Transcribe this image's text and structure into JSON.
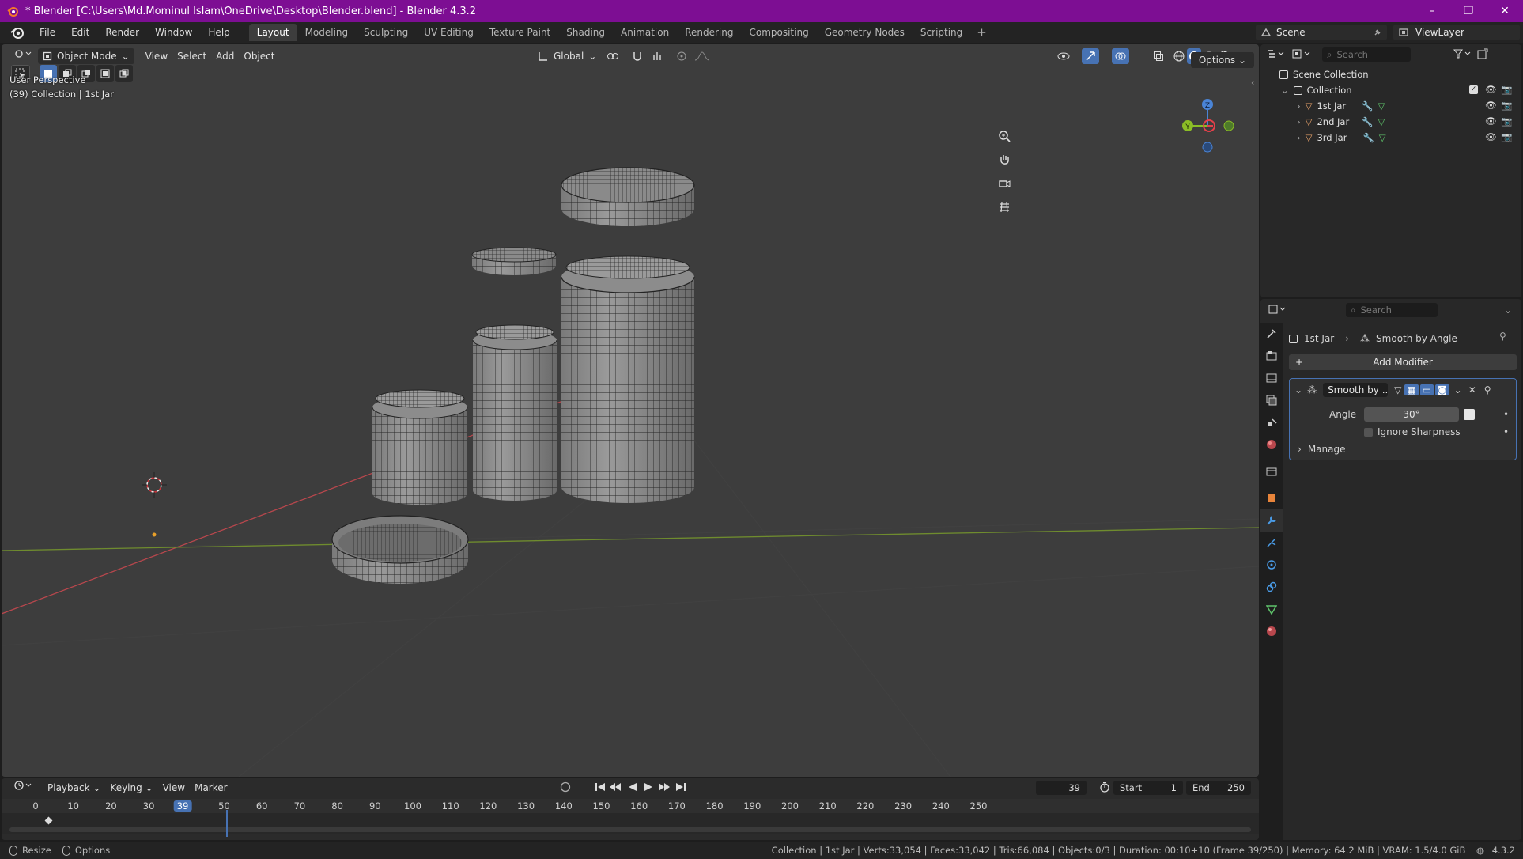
{
  "window": {
    "title": "* Blender [C:\\Users\\Md.Mominul Islam\\OneDrive\\Desktop\\Blender.blend] - Blender 4.3.2",
    "controls": [
      "–",
      "❐",
      "✕"
    ]
  },
  "menubar": {
    "items": [
      "File",
      "Edit",
      "Render",
      "Window",
      "Help"
    ],
    "workspaces": [
      "Layout",
      "Modeling",
      "Sculpting",
      "UV Editing",
      "Texture Paint",
      "Shading",
      "Animation",
      "Rendering",
      "Compositing",
      "Geometry Nodes",
      "Scripting"
    ],
    "active_workspace": "Layout",
    "add_tab": "+",
    "scene": "Scene",
    "view_layer": "ViewLayer"
  },
  "viewport": {
    "mode": "Object Mode",
    "menus": [
      "View",
      "Select",
      "Add",
      "Object"
    ],
    "transform_orientation": "Global",
    "options_label": "Options",
    "perspective": "User Perspective",
    "collection_info": "(39) Collection | 1st Jar",
    "gizmo_axes": [
      "Z",
      "Y",
      "X"
    ]
  },
  "timeline": {
    "menus": [
      "Playback",
      "Keying",
      "View",
      "Marker"
    ],
    "current_frame": "39",
    "start_label": "Start",
    "start_value": "1",
    "end_label": "End",
    "end_value": "250",
    "ruler": [
      "0",
      "10",
      "20",
      "30",
      "39",
      "50",
      "60",
      "70",
      "80",
      "90",
      "100",
      "110",
      "120",
      "130",
      "140",
      "150",
      "160",
      "170",
      "180",
      "190",
      "200",
      "210",
      "220",
      "230",
      "240",
      "250"
    ]
  },
  "statusbar": {
    "left": [
      "Resize",
      "Options"
    ],
    "right": "Collection | 1st Jar | Verts:33,054 | Faces:33,042 | Tris:66,084 | Objects:0/3 | Duration: 00:10+10 (Frame 39/250) | Memory: 64.2 MiB | VRAM: 1.5/4.0 GiB",
    "version": "4.3.2"
  },
  "outliner": {
    "search_placeholder": "Search",
    "scene_collection": "Scene Collection",
    "collection": "Collection",
    "objects": [
      "1st Jar",
      "2nd Jar",
      "3rd Jar"
    ]
  },
  "properties": {
    "search_placeholder": "Search",
    "breadcrumb_object": "1st Jar",
    "breadcrumb_modifier": "Smooth by Angle",
    "add_modifier": "Add Modifier",
    "modifier_name": "Smooth by ...",
    "angle_label": "Angle",
    "angle_value": "30°",
    "ignore_sharpness": "Ignore Sharpness",
    "manage": "Manage"
  },
  "colors": {
    "titlebar": "#7d0e93",
    "accent": "#4772b3",
    "x_axis": "#e5404a",
    "y_axis": "#8bbd26",
    "z_axis": "#4a84d6"
  }
}
